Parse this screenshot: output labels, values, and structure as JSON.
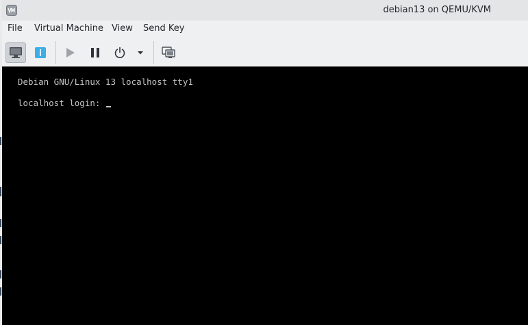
{
  "window": {
    "title": "debian13 on QEMU/KVM",
    "app_icon": "virt-manager-icon"
  },
  "menubar": {
    "items": [
      {
        "label": "File"
      },
      {
        "label": "Virtual Machine"
      },
      {
        "label": "View"
      },
      {
        "label": "Send Key"
      }
    ]
  },
  "toolbar": {
    "buttons": [
      {
        "icon": "monitor-icon",
        "action": "show-graphical-console",
        "active": true
      },
      {
        "icon": "info-icon",
        "action": "show-hardware-details",
        "active": false
      },
      {
        "icon": "play-icon",
        "action": "run",
        "enabled": false
      },
      {
        "icon": "pause-icon",
        "action": "pause",
        "enabled": true
      },
      {
        "icon": "power-icon",
        "action": "shut-down",
        "enabled": true
      },
      {
        "icon": "chevron-down-icon",
        "action": "shutdown-options",
        "enabled": true
      },
      {
        "icon": "screens-icon",
        "action": "fullscreen",
        "enabled": true
      }
    ]
  },
  "console": {
    "background": "#000000",
    "text_color": "#c4c4c4",
    "lines": [
      "Debian GNU/Linux 13 localhost tty1",
      "localhost login: "
    ]
  }
}
